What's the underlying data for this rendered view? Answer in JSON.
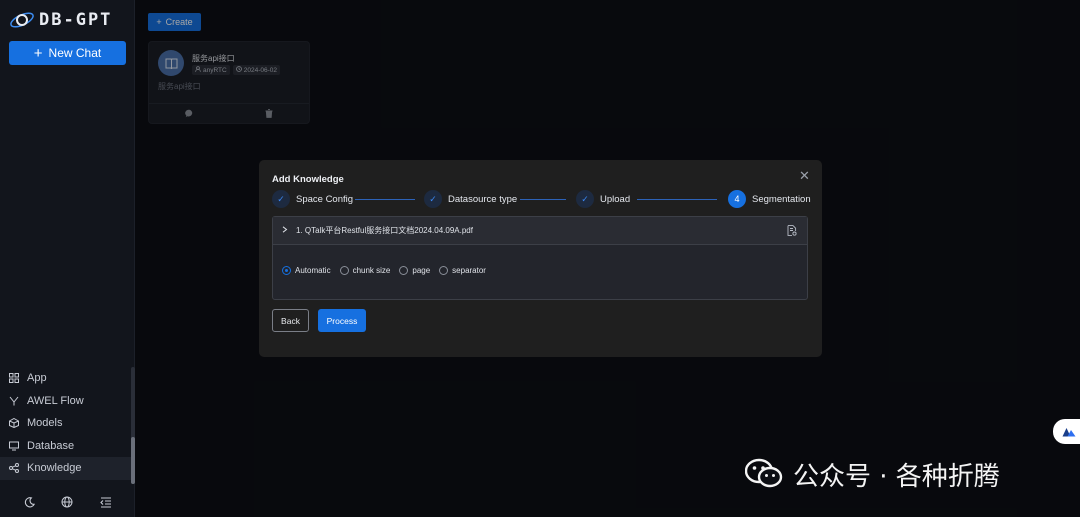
{
  "app": {
    "logo_text": "DB-GPT"
  },
  "sidebar": {
    "new_chat_label": "New Chat",
    "nav": [
      {
        "label": "App",
        "icon": "app-grid-icon"
      },
      {
        "label": "AWEL Flow",
        "icon": "flow-icon"
      },
      {
        "label": "Models",
        "icon": "cube-icon"
      },
      {
        "label": "Database",
        "icon": "database-icon"
      },
      {
        "label": "Knowledge",
        "icon": "knowledge-icon",
        "active": true
      }
    ],
    "bottom": [
      "moon-icon",
      "globe-icon",
      "collapse-menu-icon"
    ]
  },
  "main": {
    "create_label": "Create",
    "card": {
      "title": "服务api接口",
      "owner": "anyRTC",
      "date": "2024-06-02",
      "description": "服务api接口"
    }
  },
  "modal": {
    "title": "Add Knowledge",
    "steps": [
      {
        "label": "Space Config",
        "state": "done"
      },
      {
        "label": "Datasource type",
        "state": "done"
      },
      {
        "label": "Upload",
        "state": "done"
      },
      {
        "label": "Segmentation",
        "state": "current",
        "number": "4"
      }
    ],
    "file_name": "1. QTalk平台Restful服务接口文档2024.04.09A.pdf",
    "strategies": [
      {
        "label": "Automatic",
        "selected": true
      },
      {
        "label": "chunk size",
        "selected": false
      },
      {
        "label": "page",
        "selected": false
      },
      {
        "label": "separator",
        "selected": false
      }
    ],
    "back_label": "Back",
    "process_label": "Process"
  },
  "watermark": {
    "text": "公众号 · 各种折腾"
  },
  "colors": {
    "accent": "#1670e0",
    "background": "#0d0f14",
    "modal": "#1f1f1f"
  }
}
